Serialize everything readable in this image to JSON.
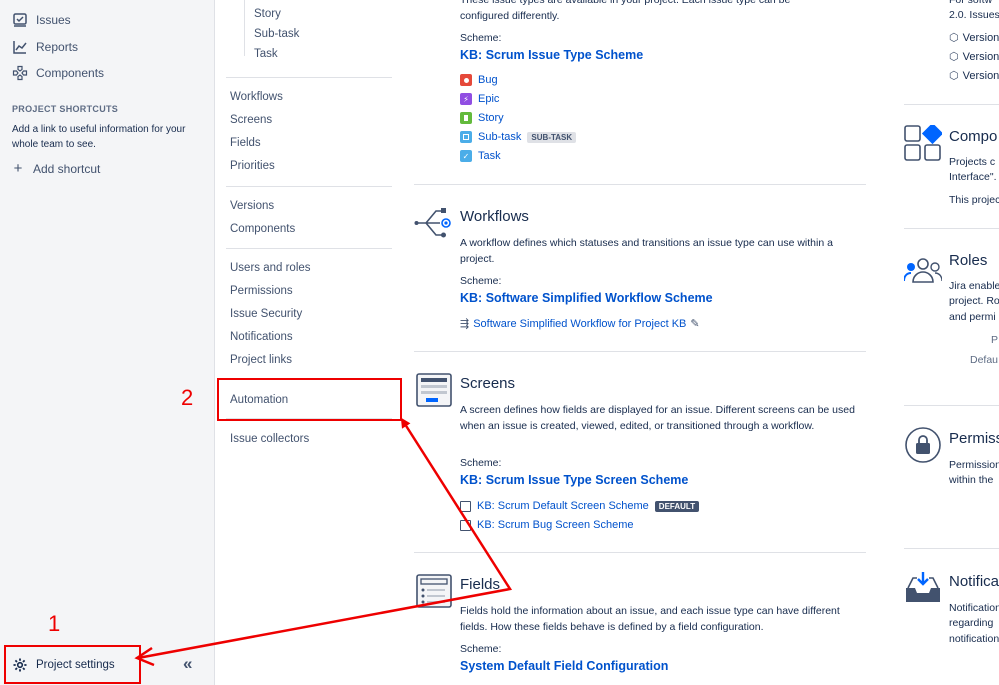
{
  "sidebar": {
    "nav": [
      {
        "label": "Issues",
        "icon": "issues-icon"
      },
      {
        "label": "Reports",
        "icon": "reports-icon"
      },
      {
        "label": "Components",
        "icon": "components-icon"
      }
    ],
    "shortcuts_heading": "PROJECT SHORTCUTS",
    "shortcuts_text": "Add a link to useful information for your whole team to see.",
    "add_shortcut": "Add shortcut",
    "project_settings": "Project settings",
    "collapse_glyph": "«"
  },
  "settings_nav": {
    "sub_items": [
      "Story",
      "Sub-task",
      "Task"
    ],
    "group1": [
      "Workflows",
      "Screens",
      "Fields",
      "Priorities"
    ],
    "group2": [
      "Versions",
      "Components"
    ],
    "group3": [
      "Users and roles",
      "Permissions",
      "Issue Security",
      "Notifications",
      "Project links"
    ],
    "automation": "Automation",
    "issue_collectors": "Issue collectors"
  },
  "main": {
    "issue_types": {
      "desc_line1": "These issue types are available in your project. Each issue type can be",
      "desc_line2": "configured differently.",
      "scheme_label": "Scheme:",
      "scheme_name": "KB: Scrum Issue Type Scheme",
      "types": [
        {
          "label": "Bug",
          "color": "#e5493a"
        },
        {
          "label": "Epic",
          "color": "#904ee2"
        },
        {
          "label": "Story",
          "color": "#63ba3c"
        },
        {
          "label": "Sub-task",
          "color": "#4bade8",
          "lozenge": "SUB-TASK"
        },
        {
          "label": "Task",
          "color": "#4bade8"
        }
      ]
    },
    "workflows": {
      "title": "Workflows",
      "desc": "A workflow defines which statuses and transitions an issue type can use within a project.",
      "scheme_label": "Scheme:",
      "scheme_name": "KB: Software Simplified Workflow Scheme",
      "item": "Software Simplified Workflow for Project KB"
    },
    "screens": {
      "title": "Screens",
      "desc": "A screen defines how fields are displayed for an issue. Different screens can be used when an issue is created, viewed, edited, or transitioned through a workflow.",
      "scheme_label": "Scheme:",
      "scheme_name": "KB: Scrum Issue Type Screen Scheme",
      "items": [
        {
          "label": "KB: Scrum Default Screen Scheme",
          "lozenge": "DEFAULT"
        },
        {
          "label": "KB: Scrum Bug Screen Scheme"
        }
      ]
    },
    "fields": {
      "title": "Fields",
      "desc": "Fields hold the information about an issue, and each issue type can have different fields. How these fields behave is defined by a field configuration.",
      "scheme_label": "Scheme:",
      "scheme_name": "System Default Field Configuration"
    }
  },
  "right": {
    "versions_text1": "For softw",
    "versions_text2": "2.0. Issues",
    "versions": [
      "Version",
      "Version",
      "Version"
    ],
    "components_title": "Compo",
    "components_text": [
      "Projects c",
      "Interface\".",
      "This projec"
    ],
    "roles_title": "Roles",
    "roles_text": [
      "Jira enable",
      "project. Ro",
      "and permi"
    ],
    "roles_extra": [
      "P",
      "Defau"
    ],
    "permissions_title": "Permiss",
    "permissions_text": [
      "Permission",
      "within the"
    ],
    "notifications_title": "Notifica",
    "notifications_text": [
      "Notification",
      "regarding",
      "notification"
    ]
  },
  "annotations": {
    "step1": "1",
    "step2": "2",
    "color": "#ee0000"
  }
}
